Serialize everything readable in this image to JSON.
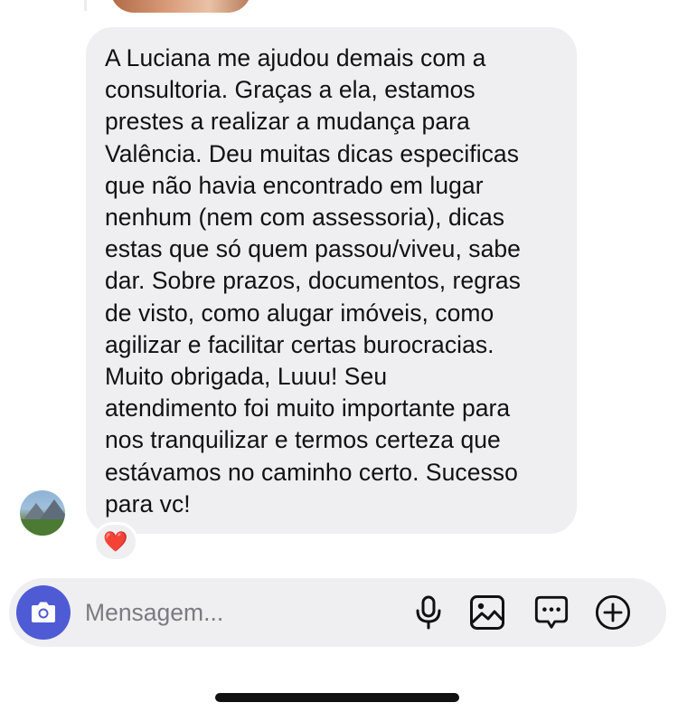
{
  "chat": {
    "message": "A Luciana me ajudou demais com a\nconsultoria. Graças a ela, estamos\nprestes a realizar a mudança para\nValência. Deu muitas dicas especificas\nque não havia encontrado em lugar\nnenhum (nem com assessoria), dicas\nestas que só quem passou/viveu, sabe\ndar. Sobre prazos, documentos, regras\nde visto, como alugar imóveis, como\nagilizar e facilitar certas burocracias.\nMuito obrigada,  Luuu!  Seu\natendimento foi muito importante para\nnos tranquilizar e  termos certeza que\nestávamos no caminho certo. Sucesso\npara vc!",
    "reaction": "❤️"
  },
  "composer": {
    "placeholder": "Mensagem...",
    "icons": [
      "camera-icon",
      "microphone-icon",
      "gallery-icon",
      "sticker-icon",
      "plus-icon"
    ]
  },
  "colors": {
    "bubble": "#efeff2",
    "accent": "#4f5bd5",
    "text": "#111111",
    "placeholder": "#7a7a80"
  }
}
